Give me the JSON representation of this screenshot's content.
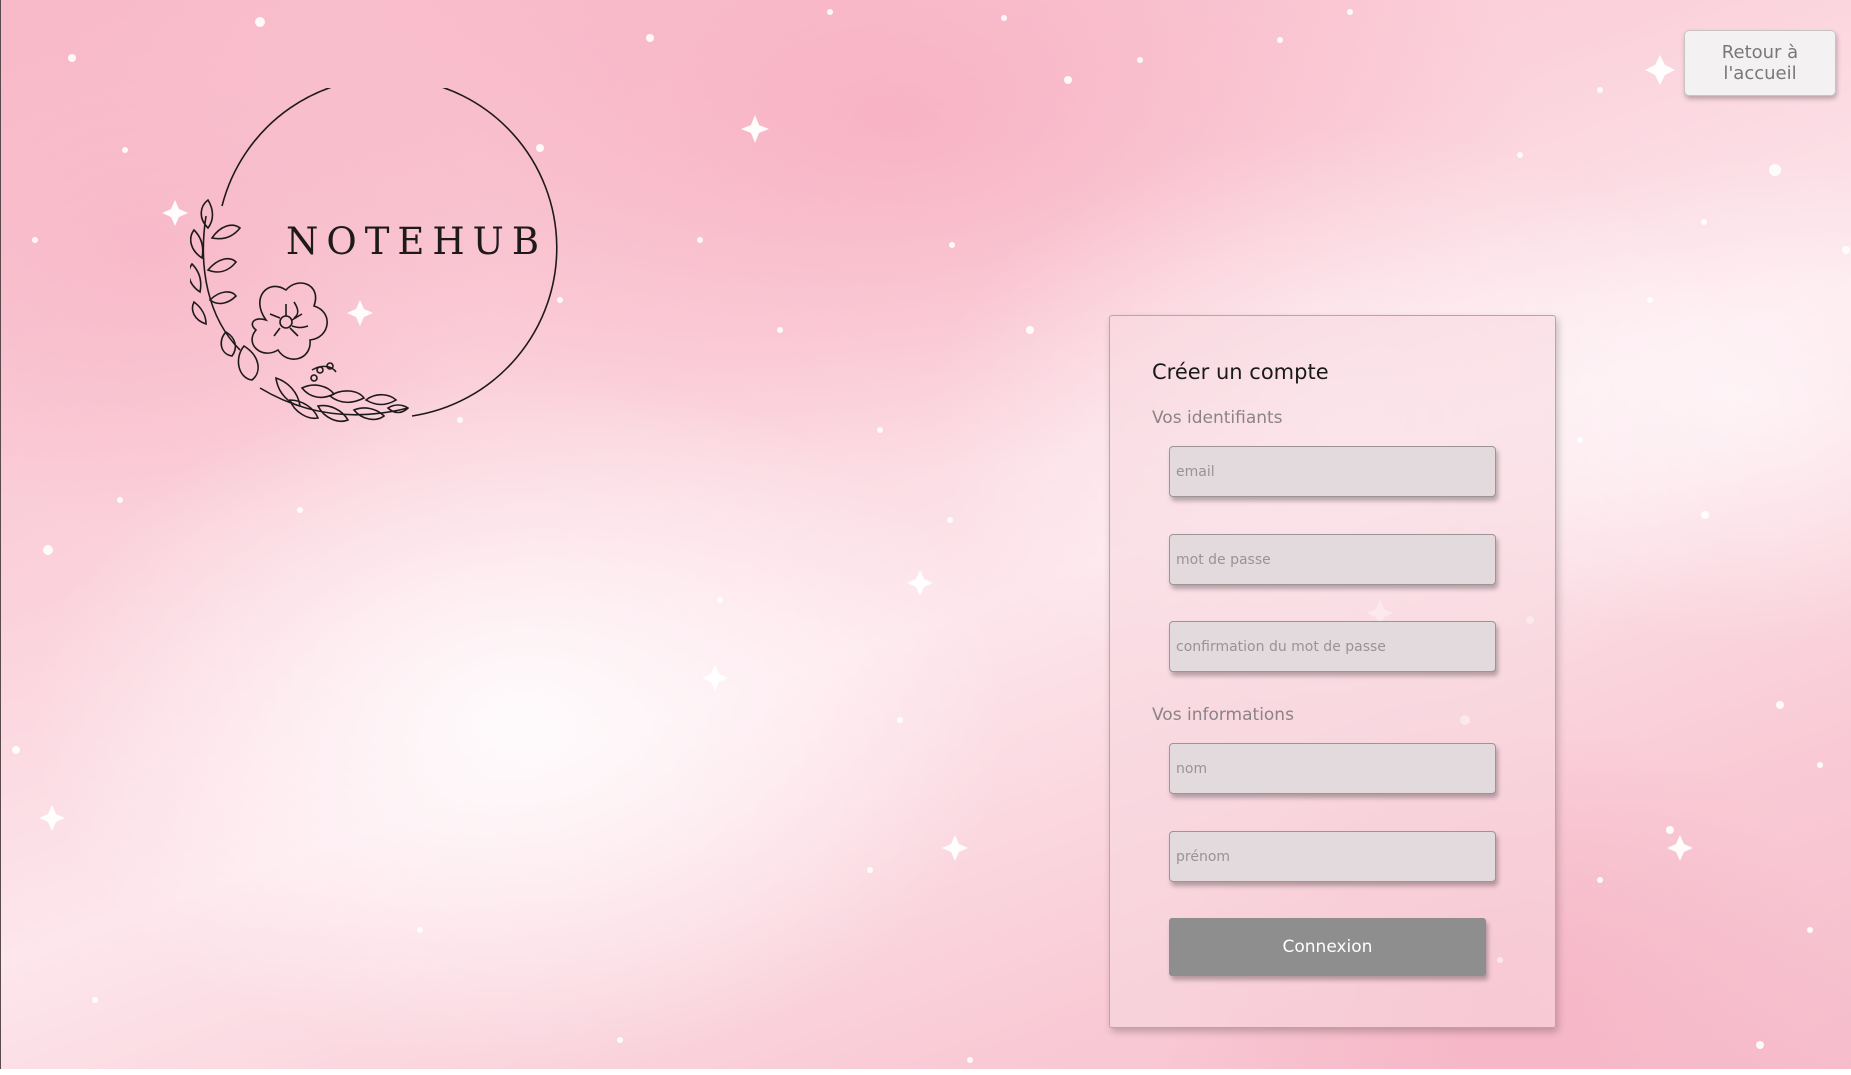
{
  "app": {
    "logo_text": "NOTEHUB"
  },
  "header": {
    "back_label": "Retour à l'accueil"
  },
  "form": {
    "title": "Créer un compte",
    "credentials_label": "Vos identifiants",
    "email_placeholder": "email",
    "password_placeholder": "mot de passe",
    "password_confirm_placeholder": "confirmation du mot de passe",
    "info_label": "Vos informations",
    "last_name_placeholder": "nom",
    "first_name_placeholder": "prénom",
    "submit_label": "Connexion"
  },
  "colors": {
    "background": "#f9c5d2",
    "card_border": "#b7a5ab",
    "field_background": "#e2dadc",
    "submit_background": "#8e8e8e",
    "logo_ink": "#1e1a1c"
  },
  "icons": {
    "logo": "flower-wreath-icon"
  }
}
